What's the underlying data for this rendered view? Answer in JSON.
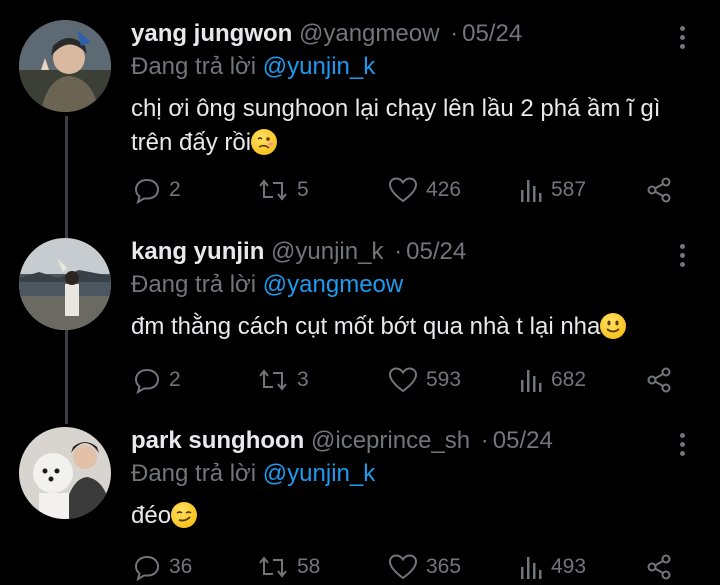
{
  "tweets": [
    {
      "name": "yang jungwon",
      "handle": "@yangmeow",
      "separator": "·",
      "date": "05/24",
      "replying_prefix": "Đang trả lời",
      "replying_to": "@yunjin_k",
      "text": "chị ơi ông sunghoon lại chạy lên lầu 2 phá ầm ĩ gì trên đấy rồi",
      "emoji": "woozy-face",
      "replies": "2",
      "retweets": "5",
      "likes": "426",
      "views": "587"
    },
    {
      "name": "kang yunjin",
      "handle": "@yunjin_k",
      "separator": "·",
      "date": "05/24",
      "replying_prefix": "Đang trả lời",
      "replying_to": "@yangmeow",
      "text": "đm thằng cách cụt mốt bớt qua nhà t lại nha",
      "emoji": "smiling-face",
      "replies": "2",
      "retweets": "3",
      "likes": "593",
      "views": "682"
    },
    {
      "name": "park sunghoon",
      "handle": "@iceprince_sh",
      "separator": "·",
      "date": "05/24",
      "replying_prefix": "Đang trả lời",
      "replying_to": "@yunjin_k",
      "text": "đéo",
      "emoji": "smirking-face",
      "replies": "36",
      "retweets": "58",
      "likes": "365",
      "views": "493"
    }
  ],
  "colors": {
    "background": "#000000",
    "text": "#e7e9ea",
    "muted": "#71767b",
    "accent": "#1d9bf0",
    "thread_line": "#3a3d42"
  }
}
